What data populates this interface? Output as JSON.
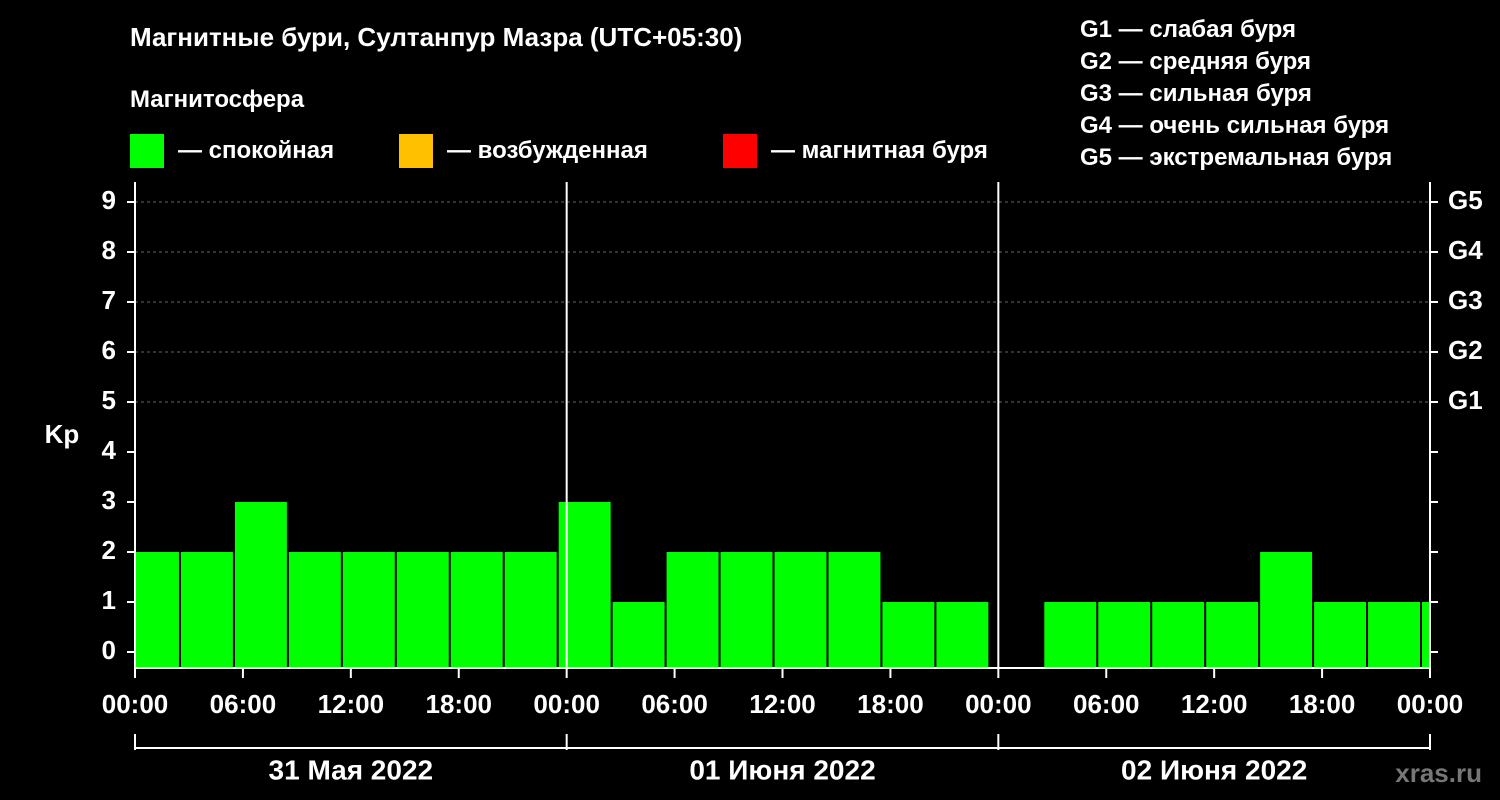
{
  "header": {
    "title": "Магнитные бури, Султанпур Мазра (UTC+05:30)",
    "subtitle": "Магнитосфера"
  },
  "legend": [
    {
      "label": "— спокойная",
      "color": "#00ff00"
    },
    {
      "label": "— возбужденная",
      "color": "#ffc000"
    },
    {
      "label": "— магнитная буря",
      "color": "#ff0000"
    }
  ],
  "gscale": [
    "G1 — слабая буря",
    "G2 — средняя буря",
    "G3 — сильная буря",
    "G4 — очень сильная буря",
    "G5 — экстремальная буря"
  ],
  "credit": "xras.ru",
  "chart_data": {
    "type": "bar",
    "ylabel": "Kp",
    "ylim": [
      0,
      9
    ],
    "yticks": [
      0,
      1,
      2,
      3,
      4,
      5,
      6,
      7,
      8,
      9
    ],
    "right_axis_labels": [
      {
        "kp": 5,
        "label": "G1"
      },
      {
        "kp": 6,
        "label": "G2"
      },
      {
        "kp": 7,
        "label": "G3"
      },
      {
        "kp": 8,
        "label": "G4"
      },
      {
        "kp": 9,
        "label": "G5"
      }
    ],
    "xtick_labels": [
      "00:00",
      "06:00",
      "12:00",
      "18:00",
      "00:00",
      "06:00",
      "12:00",
      "18:00",
      "00:00",
      "06:00",
      "12:00",
      "18:00",
      "00:00"
    ],
    "days": [
      "31 Мая 2022",
      "01 Июня 2022",
      "02 Июня 2022"
    ],
    "grid": true,
    "bar_color": "#00ff00",
    "bars": [
      {
        "start": "2022-05-31 00:00",
        "end": "2022-05-31 02:30",
        "kp": 2
      },
      {
        "start": "2022-05-31 02:30",
        "end": "2022-05-31 05:30",
        "kp": 2
      },
      {
        "start": "2022-05-31 05:30",
        "end": "2022-05-31 08:30",
        "kp": 3
      },
      {
        "start": "2022-05-31 08:30",
        "end": "2022-05-31 11:30",
        "kp": 2
      },
      {
        "start": "2022-05-31 11:30",
        "end": "2022-05-31 14:30",
        "kp": 2
      },
      {
        "start": "2022-05-31 14:30",
        "end": "2022-05-31 17:30",
        "kp": 2
      },
      {
        "start": "2022-05-31 17:30",
        "end": "2022-05-31 20:30",
        "kp": 2
      },
      {
        "start": "2022-05-31 20:30",
        "end": "2022-05-31 23:30",
        "kp": 2
      },
      {
        "start": "2022-05-31 23:30",
        "end": "2022-06-01 02:30",
        "kp": 3
      },
      {
        "start": "2022-06-01 02:30",
        "end": "2022-06-01 05:30",
        "kp": 1
      },
      {
        "start": "2022-06-01 05:30",
        "end": "2022-06-01 08:30",
        "kp": 2
      },
      {
        "start": "2022-06-01 08:30",
        "end": "2022-06-01 11:30",
        "kp": 2
      },
      {
        "start": "2022-06-01 11:30",
        "end": "2022-06-01 14:30",
        "kp": 2
      },
      {
        "start": "2022-06-01 14:30",
        "end": "2022-06-01 17:30",
        "kp": 2
      },
      {
        "start": "2022-06-01 17:30",
        "end": "2022-06-01 20:30",
        "kp": 1
      },
      {
        "start": "2022-06-01 20:30",
        "end": "2022-06-01 23:30",
        "kp": 1
      },
      {
        "start": "2022-06-02 02:30",
        "end": "2022-06-02 05:30",
        "kp": 1
      },
      {
        "start": "2022-06-02 05:30",
        "end": "2022-06-02 08:30",
        "kp": 1
      },
      {
        "start": "2022-06-02 08:30",
        "end": "2022-06-02 11:30",
        "kp": 1
      },
      {
        "start": "2022-06-02 11:30",
        "end": "2022-06-02 14:30",
        "kp": 1
      },
      {
        "start": "2022-06-02 14:30",
        "end": "2022-06-02 17:30",
        "kp": 2
      },
      {
        "start": "2022-06-02 17:30",
        "end": "2022-06-02 20:30",
        "kp": 1
      },
      {
        "start": "2022-06-02 20:30",
        "end": "2022-06-02 23:30",
        "kp": 1
      },
      {
        "start": "2022-06-02 23:30",
        "end": "2022-06-03 00:00",
        "kp": 1
      }
    ]
  }
}
